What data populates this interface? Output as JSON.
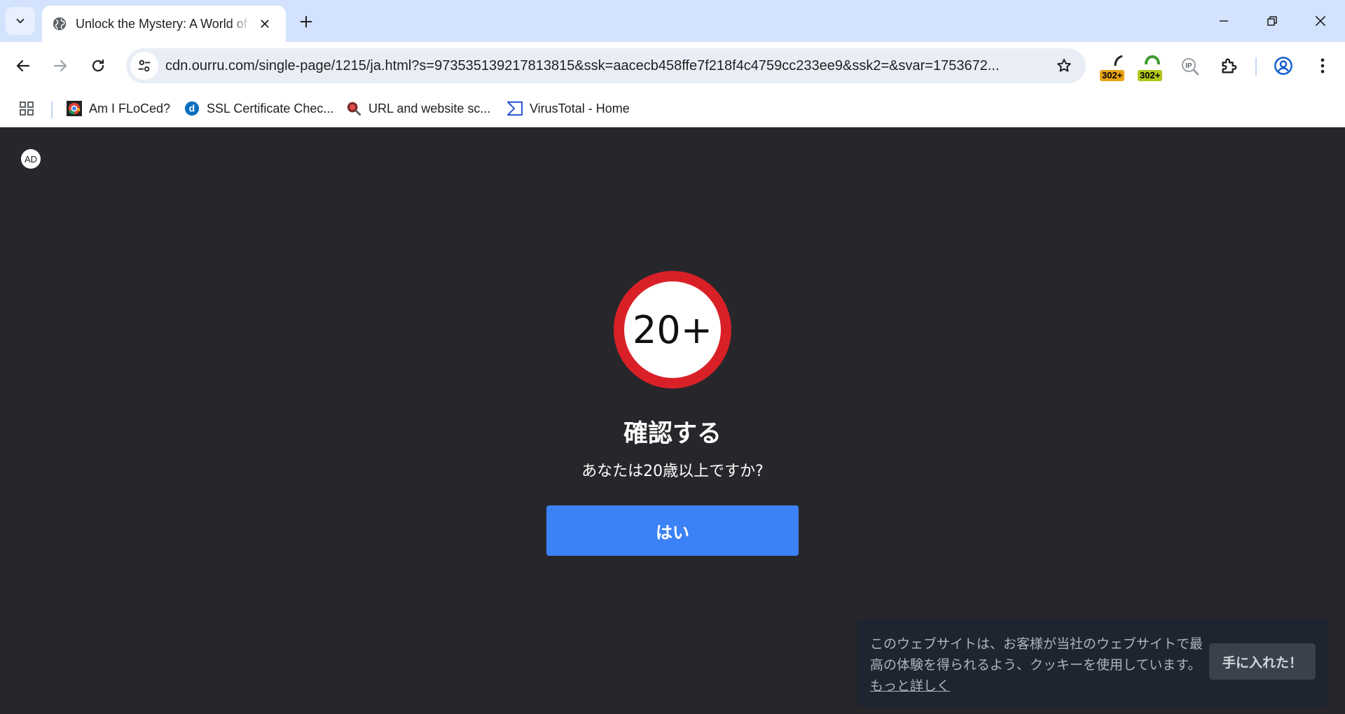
{
  "tab": {
    "title": "Unlock the Mystery: A World of Wonders"
  },
  "address_bar": {
    "url": "cdn.ourru.com/single-page/1215/ja.html?s=973535139217813815&ssk=aacecb458ffe7f218f4c4759cc233ee9&ssk2=&svar=1753672..."
  },
  "extensions": [
    {
      "name": "redirect-extension-1",
      "badge": "302+"
    },
    {
      "name": "redirect-extension-2",
      "badge": "302+"
    },
    {
      "name": "ip-extension",
      "label": "IP"
    }
  ],
  "bookmarks": [
    {
      "label": "Am I FLoCed?",
      "icon": "chrome-icon"
    },
    {
      "label": "SSL Certificate Chec...",
      "icon": "digicert-icon"
    },
    {
      "label": "URL and website sc...",
      "icon": "urlscan-icon"
    },
    {
      "label": "VirusTotal - Home",
      "icon": "virustotal-icon"
    }
  ],
  "page": {
    "ad_badge": "AD",
    "age_badge": "20+",
    "title": "確認する",
    "question": "あなたは20歳以上ですか?",
    "yes_button": "はい"
  },
  "cookie_banner": {
    "text": "このウェブサイトは、お客様が当社のウェブサイトで最高の体験を得られるよう、クッキーを使用しています。",
    "link": "もっと詳しく",
    "button": "手に入れた！"
  },
  "colors": {
    "page_background": "#27272b",
    "age_ring": "#d92027",
    "primary_button": "#3b82f6",
    "cookie_background": "#1e2430",
    "chrome_titlebar": "#d3e3fd"
  }
}
